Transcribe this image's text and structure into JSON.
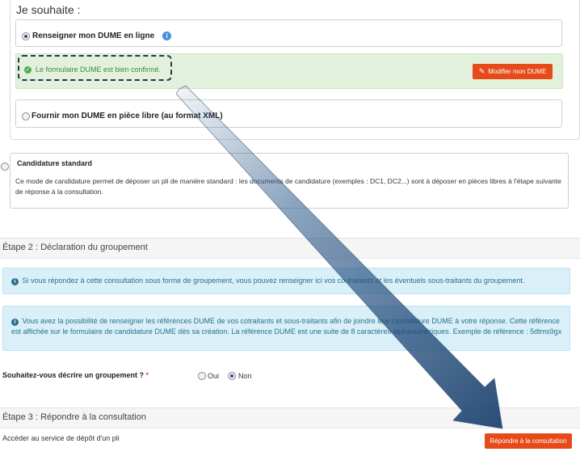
{
  "step1": {
    "heading": "Je souhaite :",
    "option_online": {
      "label": "Renseigner mon DUME en ligne",
      "selected": true,
      "info_icon": "info-circle-icon"
    },
    "success_message": "Le formulaire DUME est bien confirmé.",
    "modify_button": "Modifier mon DUME",
    "option_xml": {
      "label": "Fournir mon DUME en pièce libre (au format XML)",
      "selected": false
    },
    "standard": {
      "title": "Candidature standard",
      "description": "Ce mode de candidature permet de déposer un pli de manière standard : les documents de candidature (exemples : DC1, DC2...) sont à déposer en pièces libres à l'étape suivante de réponse à la consultation.",
      "selected": false
    }
  },
  "step2": {
    "title": "Étape 2 : Déclaration du groupement",
    "info1": "Si vous répondez à cette consultation sous forme de groupement, vous pouvez renseigner ici vos co-traitants et les éventuels sous-traitants du groupement.",
    "info2": "Vous avez la possibilité de renseigner les références DUME de vos cotraitants et sous-traitants afin de joindre leur candidature DUME à votre réponse. Cette référence est affichée sur le formulaire de candidature DUME dès sa création. La référence DUME est une suite de 8 caractères alphanumériques. Exemple de référence : 5dtms9gx",
    "question": "Souhaitez-vous décrire un groupement ?",
    "required_mark": "*",
    "yes_label": "Oui",
    "no_label": "Non",
    "selected": "Non"
  },
  "step3": {
    "title": "Étape 3 : Répondre à la consultation",
    "access_text": "Accéder au service de dépôt d'un pli",
    "respond_button": "Répondre à la consultation"
  },
  "colors": {
    "accent": "#e64a19",
    "success_bg": "#e3f1dc",
    "info_bg": "#d9f0f8",
    "arrow": "#2d5a8a"
  }
}
